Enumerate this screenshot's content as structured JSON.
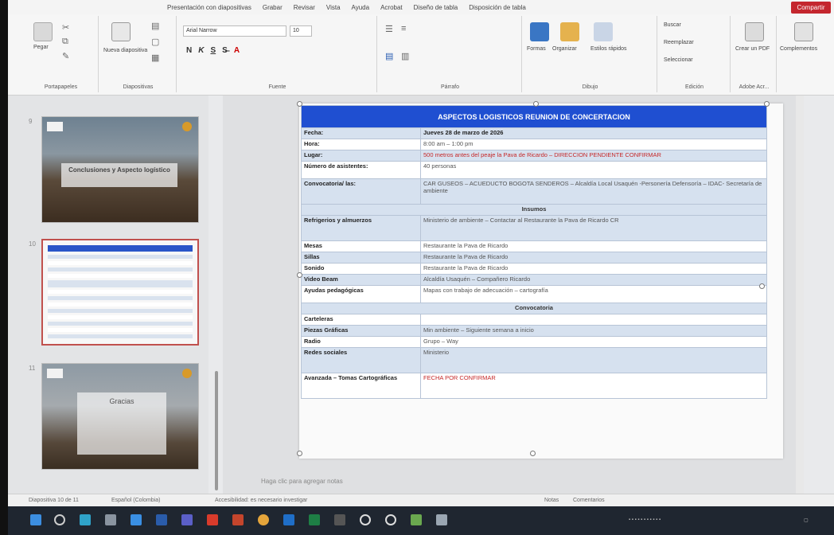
{
  "app": {
    "tabs": [
      "Presentación con diapositivas",
      "Grabar",
      "Revisar",
      "Vista",
      "Ayuda",
      "Acrobat",
      "Diseño de tabla",
      "Disposición de tabla"
    ],
    "share_label": "Compartir"
  },
  "ribbon": {
    "portapapeles": {
      "label": "Portapapeles",
      "paste": "Pegar"
    },
    "diapositivas": {
      "label": "Diapositivas",
      "new_slide": "Nueva diapositiva"
    },
    "fuente": {
      "label": "Fuente",
      "font_name": "Arial Narrow",
      "font_size": "10",
      "bold": "N",
      "italic": "K",
      "underline": "S"
    },
    "parrafo": {
      "label": "Párrafo"
    },
    "dibujo": {
      "label": "Dibujo",
      "formas": "Formas",
      "organizar": "Organizar",
      "estilos": "Estilos rápidos"
    },
    "edicion": {
      "label": "Edición",
      "buscar": "Buscar",
      "reemplazar": "Reemplazar",
      "seleccionar": "Seleccionar"
    },
    "adobe": {
      "label": "Adobe Acr...",
      "create_pdf": "Crear un PDF"
    },
    "complementos": {
      "label": "Complementos"
    }
  },
  "thumbnails": [
    {
      "number": "9",
      "title": "Conclusiones y Aspecto logístico",
      "selected": false
    },
    {
      "number": "10",
      "title": "",
      "selected": true
    },
    {
      "number": "11",
      "title": "Gracias",
      "selected": false
    }
  ],
  "slide": {
    "table_title": "ASPECTOS LOGISTICOS REUNION DE CONCERTACION",
    "rows": [
      {
        "label": "Fecha:",
        "value": "Jueves 28 de marzo de 2026",
        "style": "blue",
        "bold_value": true
      },
      {
        "label": "Hora:",
        "value": "8:00 am – 1:00 pm",
        "style": "white"
      },
      {
        "label": "Lugar:",
        "value": "500 metros antes del peaje la Pava de Ricardo – DIRECCION PENDIENTE CONFIRMAR",
        "style": "blue",
        "red": true
      },
      {
        "label": "Número de asistentes:",
        "value": "40 personas",
        "style": "white",
        "height": "med"
      },
      {
        "label": "Convocatoria/ las:",
        "value": "CAR GUSEOS – ACUEDUCTO BOGOTA SENDEROS – Alcaldía Local Usaquén -Personería Defensoría – IDAC- Secretaría de ambiente",
        "style": "blue",
        "height": "tall"
      }
    ],
    "section_insumos": "Insumos",
    "insumos": [
      {
        "label": "Refrigerios y almuerzos",
        "value": "Ministerio de ambiente – Contactar al Restaurante la Pava de Ricardo CR",
        "style": "blue",
        "height": "tall"
      },
      {
        "label": "Mesas",
        "value": "Restaurante la Pava de Ricardo",
        "style": "white"
      },
      {
        "label": "Sillas",
        "value": "Restaurante la Pava de Ricardo",
        "style": "blue"
      },
      {
        "label": "Sonido",
        "value": "Restaurante la Pava de Ricardo",
        "style": "white"
      },
      {
        "label": "Video Beam",
        "value": "Alcaldía Usaquén – Compañero Ricardo",
        "style": "blue"
      },
      {
        "label": "Ayudas pedagógicas",
        "value": "Mapas con trabajo de adecuación – cartografía",
        "style": "white",
        "height": "med"
      }
    ],
    "section_convocatoria": "Convocatoria",
    "convocatoria": [
      {
        "label": "Carteleras",
        "value": "",
        "style": "white"
      },
      {
        "label": "Piezas Gráficas",
        "value": "Min ambiente – Siguiente semana a inicio",
        "style": "blue"
      },
      {
        "label": "Radio",
        "value": "Grupo – Way",
        "style": "white"
      },
      {
        "label": "Redes sociales",
        "value": "Ministerio",
        "style": "blue",
        "height": "tall"
      },
      {
        "label": "Avanzada – Tomas Cartográficas",
        "value": "FECHA POR CONFIRMAR",
        "style": "white",
        "red": true,
        "height": "tall"
      }
    ]
  },
  "notes_hint": "Haga clic para agregar notas",
  "status": {
    "slide_info": "Diapositiva 10 de 11",
    "language": "Español (Colombia)",
    "accessibility": "Accesibilidad: es necesario investigar",
    "notes": "Notas",
    "comments": "Comentarios"
  },
  "taskbar": {
    "icons": [
      "windows-start",
      "search",
      "task-view",
      "edge",
      "file-explorer",
      "store",
      "word",
      "teams",
      "acrobat",
      "powerpoint",
      "chrome",
      "outlook",
      "excel",
      "app-dark",
      "app-circle",
      "app-circle-2",
      "app-grid",
      "app-photo"
    ]
  }
}
